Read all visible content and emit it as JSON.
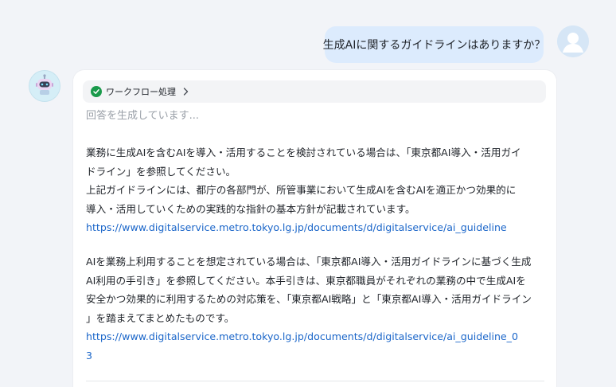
{
  "user_message": {
    "text": "生成AIに関するガイドラインはありますか？"
  },
  "bot_message": {
    "workflow_label": "ワークフロー処理",
    "status": "回答を生成しています...",
    "paragraphs": [
      {
        "lines": [
          "業務に生成AIを含むAIを導入・活用することを検討されている場合は、「東京都AI導入・活用ガイ",
          "ドライン」を参照してください。",
          "上記ガイドラインには、都庁の各部門が、所管事業において生成AIを含むAIを適正かつ効果的に",
          "導入・活用していくための実践的な指針の基本方針が記載されています。"
        ],
        "link": "https://www.digitalservice.metro.tokyo.lg.jp/documents/d/digitalservice/ai_guideline"
      },
      {
        "lines": [
          "AIを業務上利用することを想定されている場合は、「東京都AI導入・活用ガイドラインに基づく生成",
          "AI利用の手引き」を参照してください。本手引きは、東京都職員がそれぞれの業務の中で生成AIを",
          "安全かつ効果的に利用するための対応策を、「東京都AI戦略」と「東京都AI導入・活用ガイドライン",
          "」を踏まえてまとめたものです。"
        ],
        "link_lines": [
          "https://www.digitalservice.metro.tokyo.lg.jp/documents/d/digitalservice/ai_guideline_0",
          "3"
        ]
      }
    ]
  },
  "colors": {
    "user_bubble": "#dcebfd",
    "link": "#1b66c9",
    "success": "#1a9a4b"
  },
  "icons": {
    "user_avatar": "user-avatar-icon",
    "bot_avatar": "robot-avatar-icon",
    "workflow_status": "check-circle-icon",
    "workflow_expand": "chevron-right-icon"
  }
}
